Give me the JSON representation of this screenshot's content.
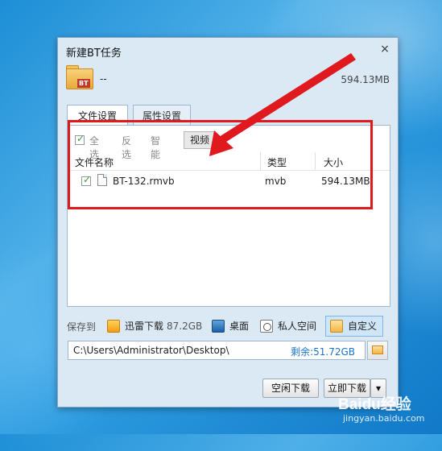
{
  "dialog": {
    "title": "新建BT任务",
    "close_glyph": "×",
    "task": {
      "name": "--",
      "size": "594.13MB",
      "icon_badge": "BT"
    }
  },
  "tabs": [
    {
      "label": "文件设置",
      "active": true
    },
    {
      "label": "属性设置",
      "active": false
    }
  ],
  "filters": {
    "select_all": "全选",
    "invert": "反选",
    "smart": "智能",
    "video": "视频",
    "select_all_checked": true
  },
  "table": {
    "columns": [
      "文件名称",
      "类型",
      "大小"
    ],
    "rows": [
      {
        "checked": true,
        "name": "BT-132.rmvb",
        "type": "mvb",
        "size": "594.13MB"
      }
    ]
  },
  "save": {
    "label": "保存到",
    "locations": [
      {
        "label": "迅雷下载",
        "free": "87.2GB",
        "icon": "thunder-download-icon"
      },
      {
        "label": "桌面",
        "icon": "desktop-icon"
      },
      {
        "label": "私人空间",
        "icon": "private-space-icon"
      },
      {
        "label": "自定义",
        "icon": "custom-folder-icon",
        "selected": true
      }
    ],
    "path": "C:\\Users\\Administrator\\Desktop\\",
    "remaining": "剩余:51.72GB",
    "browse_icon": "folder-icon"
  },
  "buttons": {
    "idle_download": "空闲下载",
    "download_now": "立即下载",
    "dropdown_glyph": "▾"
  },
  "watermark": {
    "logo": "Baidu经验",
    "url": "jingyan.baidu.com"
  },
  "annotation": {
    "color": "#e0191f"
  }
}
